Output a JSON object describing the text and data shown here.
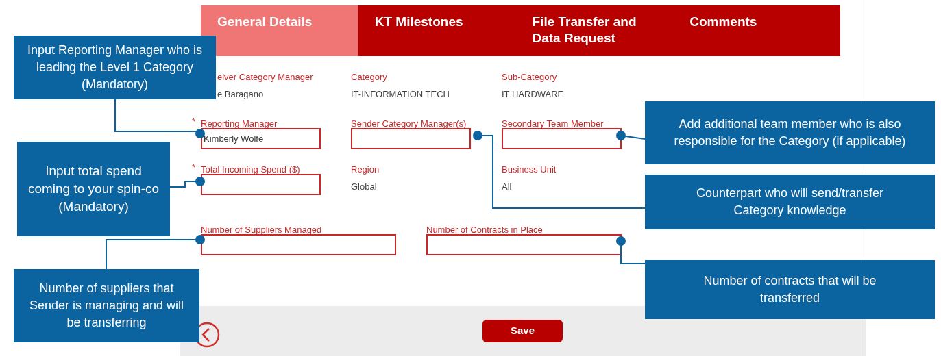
{
  "tabs": [
    {
      "label": "General Details",
      "selected": true
    },
    {
      "label": "KT Milestones",
      "selected": false
    },
    {
      "label": "File Transfer and Data Request",
      "selected": false
    },
    {
      "label": "Comments",
      "selected": false
    }
  ],
  "field_rows": [
    {
      "wide": false,
      "fields": [
        {
          "kind": "text",
          "label": "eiver Category Manager",
          "value": "e Baragano"
        },
        {
          "kind": "text",
          "label": "Category",
          "value": "IT-INFORMATION TECH"
        },
        {
          "kind": "text",
          "label": "Sub-Category",
          "value": "IT HARDWARE"
        }
      ]
    },
    {
      "wide": false,
      "fields": [
        {
          "kind": "input",
          "label": "Reporting Manager",
          "required_mark": "*",
          "value": "Kimberly Wolfe"
        },
        {
          "kind": "input",
          "label": "Sender Category Manager(s)"
        },
        {
          "kind": "input",
          "label": "Secondary Team Member"
        }
      ]
    },
    {
      "wide": false,
      "fields": [
        {
          "kind": "input",
          "label": "Total Incoming Spend ($)",
          "required_mark": "*"
        },
        {
          "kind": "text",
          "label": "Region",
          "value": "Global"
        },
        {
          "kind": "text",
          "label": "Business Unit",
          "value": "All"
        }
      ]
    },
    {
      "wide": true,
      "fields": [
        {
          "kind": "input",
          "label": "Number of Suppliers Managed"
        },
        {
          "kind": "input",
          "label": "Number of Contracts in Place"
        }
      ]
    }
  ],
  "footer": {
    "save_button": "Save"
  },
  "callouts": [
    {
      "text": "Input Reporting Manager who is leading the Level 1 Category (Mandatory)"
    },
    {
      "text": "Input total spend coming to your spin-co (Mandatory)"
    },
    {
      "text": "Number of suppliers that Sender is managing and will be transferring"
    },
    {
      "text": "Add additional team member who is also responsible for the Category (if applicable)"
    },
    {
      "text": "Counterpart who will send/transfer Category knowledge"
    },
    {
      "text": "Number of contracts that will be transferred"
    }
  ]
}
